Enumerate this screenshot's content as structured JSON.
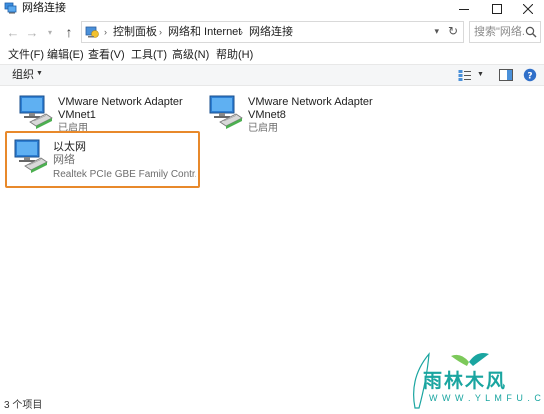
{
  "window": {
    "title": "网络连接",
    "minimize_icon": "minimize-icon",
    "maximize_icon": "maximize-icon",
    "close_icon": "close-icon"
  },
  "nav": {
    "back_icon": "arrow-left-icon",
    "forward_icon": "arrow-right-icon",
    "recent_icon": "chevron-down-icon",
    "up_icon": "arrow-up-icon"
  },
  "address": {
    "crumbs": [
      "控制面板",
      "网络和 Internet",
      "网络连接"
    ],
    "separator": "›"
  },
  "search": {
    "placeholder": "搜索\"网络..."
  },
  "menu": {
    "items": [
      "文件(F)",
      "编辑(E)",
      "查看(V)",
      "工具(T)",
      "高级(N)",
      "帮助(H)"
    ]
  },
  "toolbar": {
    "organize_label": "组织"
  },
  "adapters": [
    {
      "name": "VMware Network Adapter",
      "subname": "VMnet1",
      "status": "已启用",
      "selected": false
    },
    {
      "name": "VMware Network Adapter",
      "subname": "VMnet8",
      "status": "已启用",
      "selected": false
    },
    {
      "name": "以太网",
      "subname": "网络",
      "status": "Realtek PCIe GBE Family Contr...",
      "selected": true
    }
  ],
  "statusbar": {
    "count": "3 个项目"
  },
  "watermark": {
    "text": "雨林木风",
    "url": "W W W . Y L M F U . C O M"
  },
  "colors": {
    "selection_border": "#e8892b",
    "watermark": "#1aa5a0"
  }
}
